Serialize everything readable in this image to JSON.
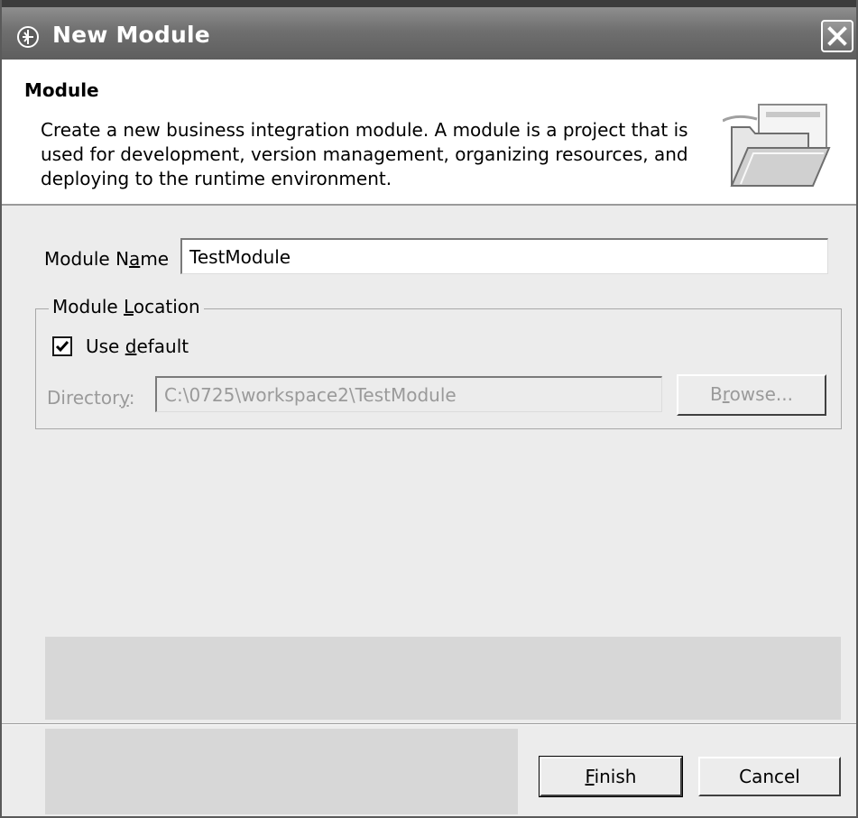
{
  "window": {
    "title": "New Module",
    "app_icon": "eclipse-wizard-icon",
    "close_icon": "close-icon"
  },
  "header": {
    "title": "Module",
    "description": "Create a new business integration module. A module is a project that is used for development, version management, organizing resources, and deploying to the runtime environment.",
    "graphic": "folder-icon"
  },
  "form": {
    "module_name_label_pre": "Module N",
    "module_name_label_mnemonic": "a",
    "module_name_label_post": "me",
    "module_name_value": "TestModule",
    "location_group": {
      "legend_pre": "Module ",
      "legend_mnemonic": "L",
      "legend_post": "ocation",
      "use_default_pre": "Use ",
      "use_default_mnemonic": "d",
      "use_default_post": "efault",
      "use_default_checked": true,
      "directory_label_pre": "Director",
      "directory_label_mnemonic": "y",
      "directory_label_post": ":",
      "directory_value": "C:\\0725\\workspace2\\TestModule",
      "browse_pre": "B",
      "browse_mnemonic": "r",
      "browse_post": "owse..."
    }
  },
  "footer": {
    "finish_mnemonic": "F",
    "finish_post": "inish",
    "cancel_label": "Cancel"
  }
}
